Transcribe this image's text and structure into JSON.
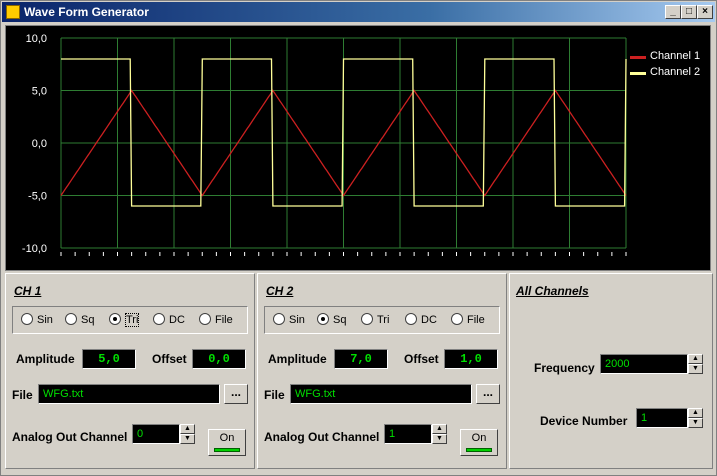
{
  "window": {
    "title": "Wave Form Generator",
    "buttons": [
      "_",
      "□",
      "×"
    ]
  },
  "chart_data": {
    "type": "line",
    "ylim": [
      -10,
      10
    ],
    "yticks": [
      "10,0",
      "5,0",
      "0,0",
      "-5,0",
      "-10,0"
    ],
    "grid": true,
    "legend_position": "top-right",
    "series": [
      {
        "name": "Channel 1",
        "color": "#cc2020",
        "shape": "triangle",
        "amplitude": 5.0,
        "offset": 0.0,
        "periods": 4
      },
      {
        "name": "Channel 2",
        "color": "#ffff99",
        "shape": "square",
        "amplitude": 7.0,
        "offset": 1.0,
        "periods": 4
      }
    ]
  },
  "ch1": {
    "heading": "CH 1",
    "radios": [
      {
        "label": "Sin",
        "selected": false
      },
      {
        "label": "Sq",
        "selected": false
      },
      {
        "label": "Tri",
        "selected": true
      },
      {
        "label": "DC",
        "selected": false
      },
      {
        "label": "File",
        "selected": false
      }
    ],
    "amplitude_label": "Amplitude",
    "amplitude": "5,0",
    "offset_label": "Offset",
    "offset": "0,0",
    "file_label": "File",
    "file": "WFG.txt",
    "browse": "...",
    "analog_label": "Analog Out Channel",
    "analog_channel": "0",
    "on_label": "On"
  },
  "ch2": {
    "heading": "CH 2",
    "radios": [
      {
        "label": "Sin",
        "selected": false
      },
      {
        "label": "Sq",
        "selected": true
      },
      {
        "label": "Tri",
        "selected": false
      },
      {
        "label": "DC",
        "selected": false
      },
      {
        "label": "File",
        "selected": false
      }
    ],
    "amplitude_label": "Amplitude",
    "amplitude": "7,0",
    "offset_label": "Offset",
    "offset": "1,0",
    "file_label": "File",
    "file": "WFG.txt",
    "browse": "...",
    "analog_label": "Analog Out Channel",
    "analog_channel": "1",
    "on_label": "On"
  },
  "all": {
    "heading": "All Channels",
    "frequency_label": "Frequency",
    "frequency": "2000",
    "device_label": "Device Number",
    "device": "1"
  }
}
